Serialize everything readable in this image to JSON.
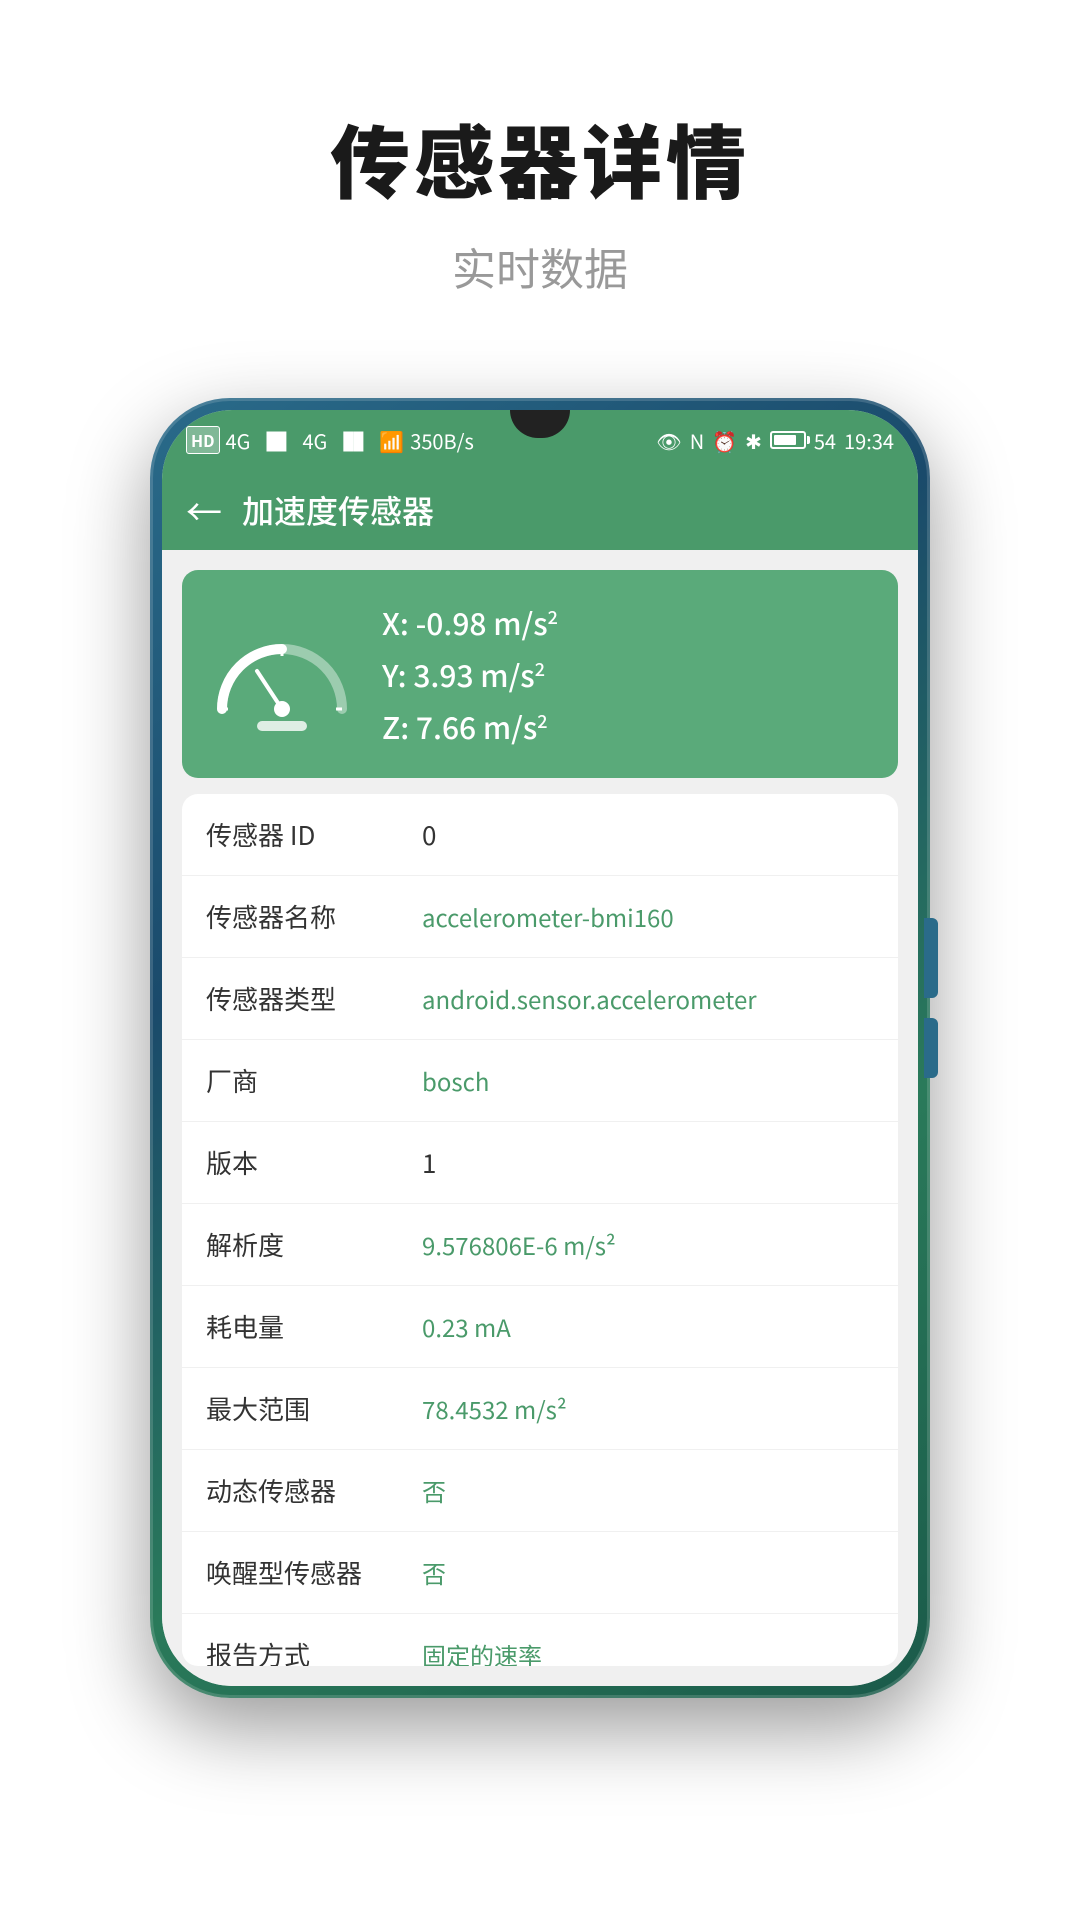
{
  "page": {
    "title": "传感器详情",
    "subtitle": "实时数据"
  },
  "status_bar": {
    "left_items": [
      "HD",
      "4G",
      "4G",
      "350B/s"
    ],
    "time": "19:34",
    "battery_pct": "54"
  },
  "toolbar": {
    "back_label": "←",
    "title": "加速度传感器"
  },
  "gauge": {
    "x_label": "X: -0.98 m/s",
    "y_label": "Y: 3.93 m/s",
    "z_label": "Z: 7.66 m/s"
  },
  "sensor_info": [
    {
      "label": "传感器 ID",
      "value": "0",
      "green": false
    },
    {
      "label": "传感器名称",
      "value": "accelerometer-bmi160",
      "green": true
    },
    {
      "label": "传感器类型",
      "value": "android.sensor.accelerometer",
      "green": true
    },
    {
      "label": "厂商",
      "value": "bosch",
      "green": true
    },
    {
      "label": "版本",
      "value": "1",
      "green": false
    },
    {
      "label": "解析度",
      "value": "9.576806E-6 m/s²",
      "green": true
    },
    {
      "label": "耗电量",
      "value": "0.23  mA",
      "green": true
    },
    {
      "label": "最大范围",
      "value": "78.4532 m/s²",
      "green": true
    },
    {
      "label": "动态传感器",
      "value": "否",
      "green": true
    },
    {
      "label": "唤醒型传感器",
      "value": "否",
      "green": true
    },
    {
      "label": "报告方式",
      "value": "固定的速率",
      "green": true
    }
  ]
}
